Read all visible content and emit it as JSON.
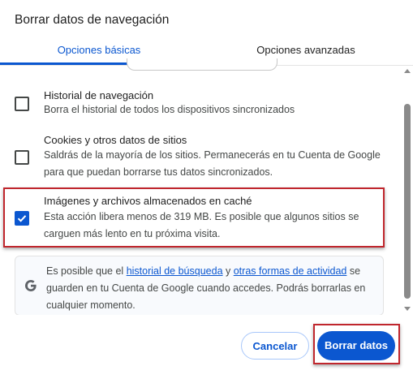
{
  "dialog": {
    "title": "Borrar datos de navegación"
  },
  "tabs": [
    {
      "label": "Opciones básicas",
      "selected": true
    },
    {
      "label": "Opciones avanzadas",
      "selected": false
    }
  ],
  "options": [
    {
      "title": "Historial de navegación",
      "description": "Borra el historial de todos los dispositivos sincronizados",
      "checked": false
    },
    {
      "title": "Cookies y otros datos de sitios",
      "description": "Saldrás de la mayoría de los sitios. Permanecerás en tu Cuenta de Google para que puedan borrarse tus datos sincronizados.",
      "checked": false
    },
    {
      "title": "Imágenes y archivos almacenados en caché",
      "description": "Esta acción libera menos de 319 MB. Es posible que algunos sitios se carguen más lento en tu próxima visita.",
      "checked": true
    }
  ],
  "info": {
    "text_before": "Es posible que el ",
    "link1": "historial de búsqueda",
    "text_middle": " y ",
    "link2": "otras formas de actividad",
    "text_after": " se guarden en tu Cuenta de Google cuando accedes. Podrás borrarlas en cualquier momento.",
    "icon": "google-g-icon"
  },
  "buttons": {
    "cancel": "Cancelar",
    "delete": "Borrar datos"
  },
  "colors": {
    "accent": "#0b57d0",
    "highlight": "#c0262d"
  }
}
